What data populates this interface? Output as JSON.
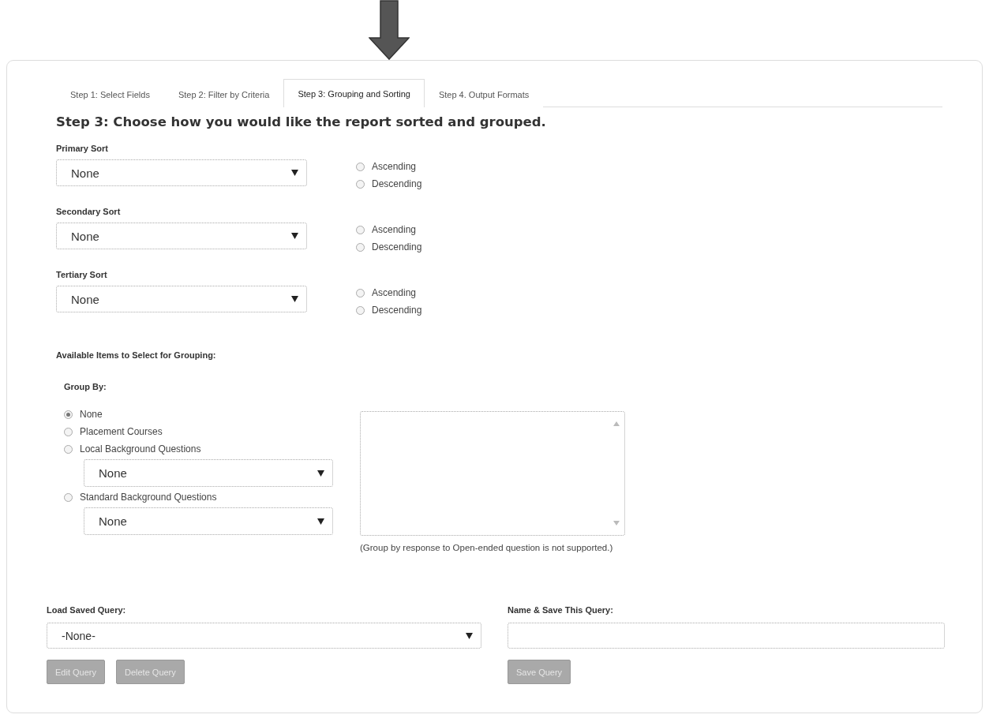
{
  "tabs": [
    {
      "label": "Step 1: Select Fields",
      "selected": false
    },
    {
      "label": "Step 2: Filter by Criteria",
      "selected": false
    },
    {
      "label": "Step 3: Grouping and Sorting",
      "selected": true
    },
    {
      "label": "Step 4. Output Formats",
      "selected": false
    }
  ],
  "heading": "Step 3: Choose how you would like the report sorted and grouped.",
  "sorts": [
    {
      "label": "Primary Sort",
      "value": "None",
      "options": [
        {
          "label": "Ascending",
          "selected": false
        },
        {
          "label": "Descending",
          "selected": false
        }
      ]
    },
    {
      "label": "Secondary Sort",
      "value": "None",
      "options": [
        {
          "label": "Ascending",
          "selected": false
        },
        {
          "label": "Descending",
          "selected": false
        }
      ]
    },
    {
      "label": "Tertiary Sort",
      "value": "None",
      "options": [
        {
          "label": "Ascending",
          "selected": false
        },
        {
          "label": "Descending",
          "selected": false
        }
      ]
    }
  ],
  "grouping": {
    "title": "Available Items to Select for Grouping:",
    "group_by_label": "Group By:",
    "options": [
      {
        "label": "None",
        "selected": true
      },
      {
        "label": "Placement Courses",
        "selected": false
      },
      {
        "label": "Local Background Questions",
        "selected": false,
        "select_value": "None"
      },
      {
        "label": "Standard Background Questions",
        "selected": false,
        "select_value": "None"
      }
    ],
    "note": "(Group by response to Open-ended question is not supported.)"
  },
  "load_query": {
    "label": "Load Saved Query:",
    "value": "-None-",
    "buttons": [
      {
        "label": "Edit Query",
        "disabled": true
      },
      {
        "label": "Delete Query",
        "disabled": true
      }
    ]
  },
  "save_query": {
    "label": "Name & Save This Query:",
    "buttons": [
      {
        "label": "Save Query",
        "disabled": true
      }
    ]
  }
}
